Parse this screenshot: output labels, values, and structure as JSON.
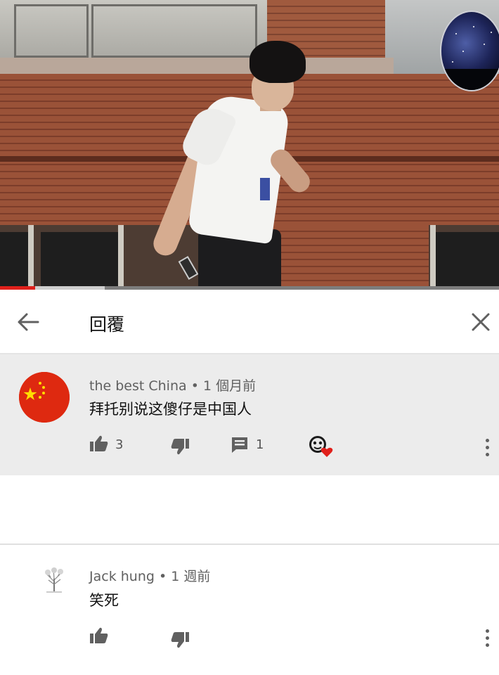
{
  "header": {
    "title": "回覆"
  },
  "video": {
    "progress_fraction": 0.07,
    "buffered_fraction": 0.21
  },
  "comments": [
    {
      "author": "the best China",
      "separator": "•",
      "time": "1 個月前",
      "text": "拜托别说这傻仔是中国人",
      "likes": "3",
      "replies": "1",
      "creator_hearted": true,
      "avatar": "china-flag"
    },
    {
      "author": "Jack hung",
      "separator": "•",
      "time": "1 週前",
      "text": "笑死",
      "avatar": "tree-sketch"
    }
  ],
  "colors": {
    "accent_red": "#e0201b",
    "highlight_bg": "#ececec",
    "icon_gray": "#606060",
    "flag_red": "#de2910",
    "flag_yellow": "#ffde00"
  },
  "icons": {
    "back": "arrow-left-icon",
    "close": "close-icon",
    "like": "thumbs-up-icon",
    "dislike": "thumbs-down-icon",
    "reply": "comment-icon",
    "heart": "creator-heart-icon",
    "more": "more-vertical-icon"
  }
}
